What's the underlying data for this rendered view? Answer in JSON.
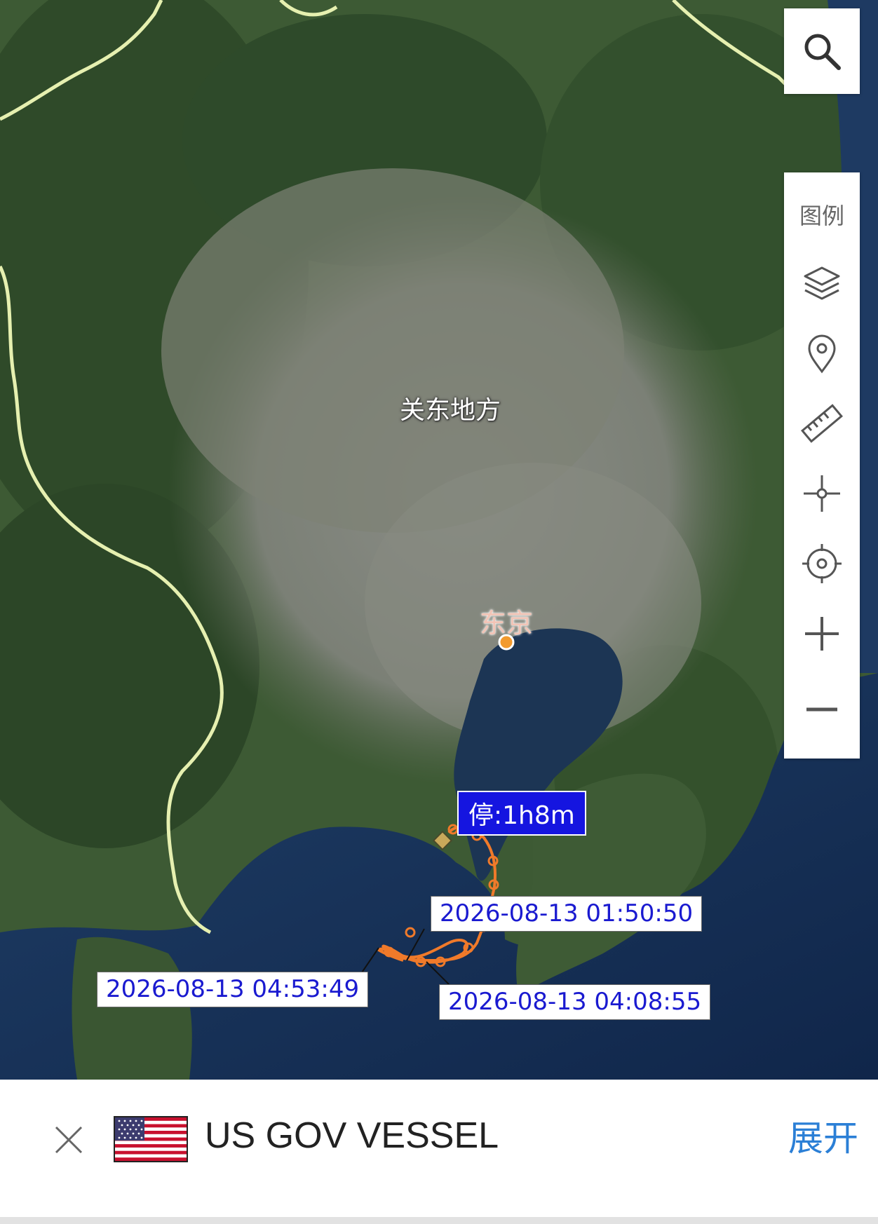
{
  "map": {
    "region_label": "关东地方",
    "city_label": "东京",
    "stop_label": "停:1h8m",
    "timestamps": [
      "2026-08-13 01:50:50",
      "2026-08-13 04:53:49",
      "2026-08-13 04:08:55"
    ],
    "track_color": "#f07a2a",
    "city_dot_color": "#f29a2e",
    "label_text_color": "#1a1ad0"
  },
  "controls": {
    "search_icon": "search-icon",
    "legend_label": "图例",
    "tools": [
      "layers-icon",
      "location-pin-icon",
      "ruler-icon",
      "crosshair-icon",
      "locate-icon",
      "zoom-in-icon",
      "zoom-out-icon"
    ]
  },
  "vessel_bar": {
    "name": "US GOV VESSEL",
    "expand_label": "展开",
    "flag_icon": "us-flag-icon",
    "close_icon": "close-icon"
  }
}
